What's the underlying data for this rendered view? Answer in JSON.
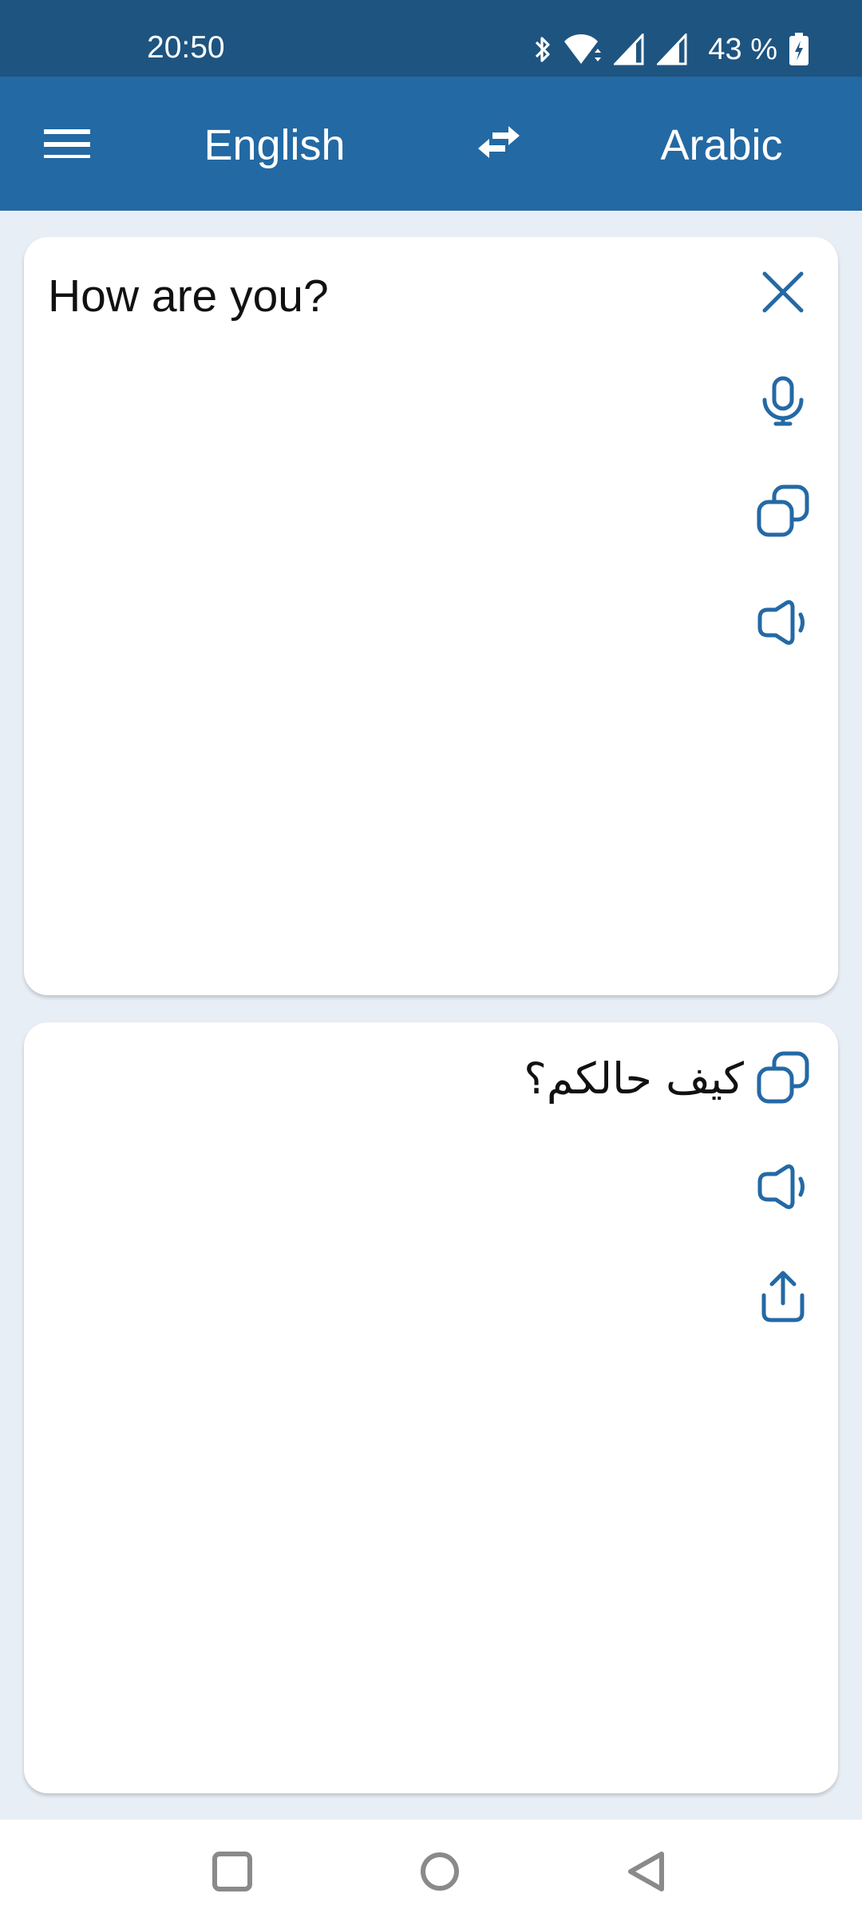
{
  "status_bar": {
    "time": "20:50",
    "battery_percent": "43 %",
    "icons": [
      "bluetooth-icon",
      "wifi-icon",
      "signal-icon",
      "signal-icon",
      "battery-charging-icon"
    ]
  },
  "app_bar": {
    "menu_icon": "hamburger-menu-icon",
    "source_language": "English",
    "swap_icon": "swap-languages-icon",
    "target_language": "Arabic"
  },
  "source_card": {
    "text": "How are you?",
    "actions": [
      {
        "icon": "close-icon",
        "label": "Clear"
      },
      {
        "icon": "microphone-icon",
        "label": "Voice input"
      },
      {
        "icon": "copy-icon",
        "label": "Copy"
      },
      {
        "icon": "speaker-icon",
        "label": "Speak"
      }
    ]
  },
  "target_card": {
    "text": "كيف حالكم؟",
    "actions": [
      {
        "icon": "copy-icon",
        "label": "Copy"
      },
      {
        "icon": "speaker-icon",
        "label": "Speak"
      },
      {
        "icon": "share-icon",
        "label": "Share"
      }
    ]
  },
  "colors": {
    "status_bar": "#1e5480",
    "app_bar": "#2369a3",
    "accent_icon": "#2469a5",
    "background": "#e8eef6",
    "nav_icon": "#8a8a8a"
  },
  "nav_bar": {
    "buttons": [
      "recents-icon",
      "home-icon",
      "back-icon"
    ]
  }
}
